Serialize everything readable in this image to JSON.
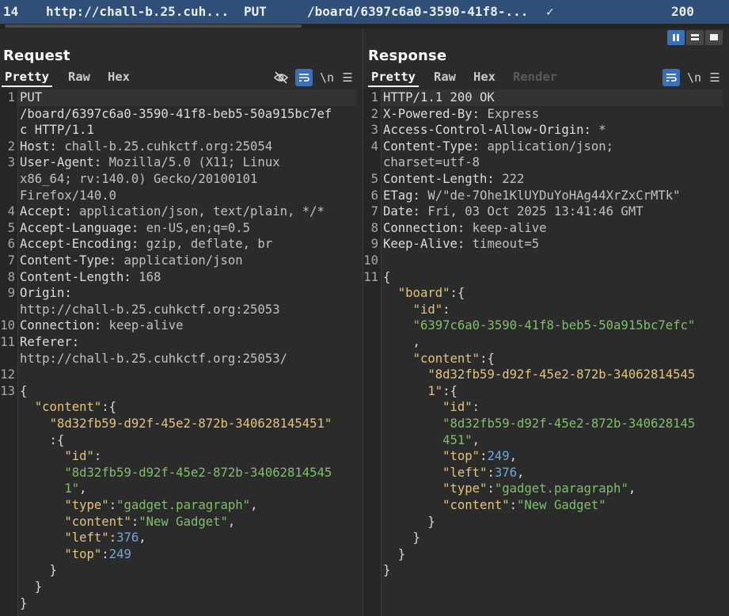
{
  "history_row": {
    "number": "14",
    "host": "http://chall-b.25.cuh...",
    "method": "PUT",
    "path": "/board/6397c6a0-3590-41f8-...",
    "check": "✓",
    "status": "200"
  },
  "request": {
    "title": "Request",
    "tabs": [
      "Pretty",
      "Raw",
      "Hex"
    ],
    "active_tab": "Pretty",
    "tools": {
      "hide_icon": "eye-off-icon",
      "wrap_icon": "wrap-icon",
      "newline_label": "\\n",
      "menu_icon": "menu-icon"
    }
  },
  "response": {
    "title": "Response",
    "tabs": [
      "Pretty",
      "Raw",
      "Hex",
      "Render"
    ],
    "active_tab": "Pretty",
    "tools": {
      "wrap_icon": "wrap-icon",
      "newline_label": "\\n",
      "menu_icon": "menu-icon"
    }
  },
  "request_lines": [
    {
      "n": "1",
      "segs": [
        [
          "hk",
          "PUT"
        ]
      ]
    },
    {
      "n": "",
      "segs": [
        [
          "hk",
          "/board/6397c6a0-3590-41f8-beb5-50a915bc7ef"
        ]
      ]
    },
    {
      "n": "",
      "segs": [
        [
          "hk",
          "c HTTP/1.1"
        ]
      ]
    },
    {
      "n": "2",
      "segs": [
        [
          "hk",
          "Host:"
        ],
        [
          "hv",
          " chall-b.25.cuhkctf.org:25054"
        ]
      ]
    },
    {
      "n": "3",
      "segs": [
        [
          "hk",
          "User-Agent:"
        ],
        [
          "hv",
          " Mozilla/5.0 (X11; Linux"
        ]
      ]
    },
    {
      "n": "",
      "segs": [
        [
          "hv",
          "x86_64; rv:140.0) Gecko/20100101"
        ]
      ]
    },
    {
      "n": "",
      "segs": [
        [
          "hv",
          "Firefox/140.0"
        ]
      ]
    },
    {
      "n": "4",
      "segs": [
        [
          "hk",
          "Accept:"
        ],
        [
          "hv",
          " application/json, text/plain, */*"
        ]
      ]
    },
    {
      "n": "5",
      "segs": [
        [
          "hk",
          "Accept-Language:"
        ],
        [
          "hv",
          " en-US,en;q=0.5"
        ]
      ]
    },
    {
      "n": "6",
      "segs": [
        [
          "hk",
          "Accept-Encoding:"
        ],
        [
          "hv",
          " gzip, deflate, br"
        ]
      ]
    },
    {
      "n": "7",
      "segs": [
        [
          "hk",
          "Content-Type:"
        ],
        [
          "hv",
          " application/json"
        ]
      ]
    },
    {
      "n": "8",
      "segs": [
        [
          "hk",
          "Content-Length:"
        ],
        [
          "hv",
          " 168"
        ]
      ]
    },
    {
      "n": "9",
      "segs": [
        [
          "hk",
          "Origin:"
        ]
      ]
    },
    {
      "n": "",
      "segs": [
        [
          "hv",
          "http://chall-b.25.cuhkctf.org:25053"
        ]
      ]
    },
    {
      "n": "10",
      "segs": [
        [
          "hk",
          "Connection:"
        ],
        [
          "hv",
          " keep-alive"
        ]
      ]
    },
    {
      "n": "11",
      "segs": [
        [
          "hk",
          "Referer:"
        ]
      ]
    },
    {
      "n": "",
      "segs": [
        [
          "hv",
          "http://chall-b.25.cuhkctf.org:25053/"
        ]
      ]
    },
    {
      "n": "12",
      "segs": []
    },
    {
      "n": "13",
      "segs": [
        [
          "jp",
          "{"
        ]
      ]
    },
    {
      "n": "",
      "segs": [
        [
          "jp",
          "  "
        ],
        [
          "jk",
          "\"content\""
        ],
        [
          "jp",
          ":{"
        ]
      ]
    },
    {
      "n": "",
      "segs": [
        [
          "jp",
          "    "
        ],
        [
          "jk",
          "\"8d32fb59-d92f-45e2-872b-340628145451\""
        ]
      ]
    },
    {
      "n": "",
      "segs": [
        [
          "jp",
          "    :{"
        ]
      ]
    },
    {
      "n": "",
      "segs": [
        [
          "jp",
          "      "
        ],
        [
          "jk",
          "\"id\""
        ],
        [
          "jp",
          ":"
        ]
      ]
    },
    {
      "n": "",
      "segs": [
        [
          "jp",
          "      "
        ],
        [
          "js",
          "\"8d32fb59-d92f-45e2-872b-34062814545"
        ]
      ]
    },
    {
      "n": "",
      "segs": [
        [
          "jp",
          "      "
        ],
        [
          "js",
          "1\""
        ],
        [
          "jp",
          ","
        ]
      ]
    },
    {
      "n": "",
      "segs": [
        [
          "jp",
          "      "
        ],
        [
          "jk",
          "\"type\""
        ],
        [
          "jp",
          ":"
        ],
        [
          "js",
          "\"gadget.paragraph\""
        ],
        [
          "jp",
          ","
        ]
      ]
    },
    {
      "n": "",
      "segs": [
        [
          "jp",
          "      "
        ],
        [
          "jk",
          "\"content\""
        ],
        [
          "jp",
          ":"
        ],
        [
          "js",
          "\"New Gadget\""
        ],
        [
          "jp",
          ","
        ]
      ]
    },
    {
      "n": "",
      "segs": [
        [
          "jp",
          "      "
        ],
        [
          "jk",
          "\"left\""
        ],
        [
          "jp",
          ":"
        ],
        [
          "jn",
          "376"
        ],
        [
          "jp",
          ","
        ]
      ]
    },
    {
      "n": "",
      "segs": [
        [
          "jp",
          "      "
        ],
        [
          "jk",
          "\"top\""
        ],
        [
          "jp",
          ":"
        ],
        [
          "jn",
          "249"
        ]
      ]
    },
    {
      "n": "",
      "segs": [
        [
          "jp",
          "    }"
        ]
      ]
    },
    {
      "n": "",
      "segs": [
        [
          "jp",
          "  }"
        ]
      ]
    },
    {
      "n": "",
      "segs": [
        [
          "jp",
          "}"
        ]
      ]
    }
  ],
  "response_lines": [
    {
      "n": "1",
      "segs": [
        [
          "hk",
          "HTTP/1.1 200 OK"
        ]
      ]
    },
    {
      "n": "2",
      "segs": [
        [
          "hk",
          "X-Powered-By:"
        ],
        [
          "hv",
          " Express"
        ]
      ]
    },
    {
      "n": "3",
      "segs": [
        [
          "hk",
          "Access-Control-Allow-Origin:"
        ],
        [
          "hv",
          " *"
        ]
      ]
    },
    {
      "n": "4",
      "segs": [
        [
          "hk",
          "Content-Type:"
        ],
        [
          "hv",
          " application/json;"
        ]
      ]
    },
    {
      "n": "",
      "segs": [
        [
          "hv",
          "charset=utf-8"
        ]
      ]
    },
    {
      "n": "5",
      "segs": [
        [
          "hk",
          "Content-Length:"
        ],
        [
          "hv",
          " 222"
        ]
      ]
    },
    {
      "n": "6",
      "segs": [
        [
          "hk",
          "ETag:"
        ],
        [
          "hv",
          " W/\"de-7Ohe1KlUYDuYoHAg44XrZxCrMTk\""
        ]
      ]
    },
    {
      "n": "7",
      "segs": [
        [
          "hk",
          "Date:"
        ],
        [
          "hv",
          " Fri, 03 Oct 2025 13:41:46 GMT"
        ]
      ]
    },
    {
      "n": "8",
      "segs": [
        [
          "hk",
          "Connection:"
        ],
        [
          "hv",
          " keep-alive"
        ]
      ]
    },
    {
      "n": "9",
      "segs": [
        [
          "hk",
          "Keep-Alive:"
        ],
        [
          "hv",
          " timeout=5"
        ]
      ]
    },
    {
      "n": "10",
      "segs": []
    },
    {
      "n": "11",
      "segs": [
        [
          "jp",
          "{"
        ]
      ]
    },
    {
      "n": "",
      "segs": [
        [
          "jp",
          "  "
        ],
        [
          "jk",
          "\"board\""
        ],
        [
          "jp",
          ":{"
        ]
      ]
    },
    {
      "n": "",
      "segs": [
        [
          "jp",
          "    "
        ],
        [
          "jk",
          "\"id\""
        ],
        [
          "jp",
          ":"
        ]
      ]
    },
    {
      "n": "",
      "segs": [
        [
          "jp",
          "    "
        ],
        [
          "js",
          "\"6397c6a0-3590-41f8-beb5-50a915bc7efc\""
        ]
      ]
    },
    {
      "n": "",
      "segs": [
        [
          "jp",
          "    ,"
        ]
      ]
    },
    {
      "n": "",
      "segs": [
        [
          "jp",
          "    "
        ],
        [
          "jk",
          "\"content\""
        ],
        [
          "jp",
          ":{"
        ]
      ]
    },
    {
      "n": "",
      "segs": [
        [
          "jp",
          "      "
        ],
        [
          "jk",
          "\"8d32fb59-d92f-45e2-872b-34062814545"
        ]
      ]
    },
    {
      "n": "",
      "segs": [
        [
          "jp",
          "      "
        ],
        [
          "jk",
          "1\""
        ],
        [
          "jp",
          ":{"
        ]
      ]
    },
    {
      "n": "",
      "segs": [
        [
          "jp",
          "        "
        ],
        [
          "jk",
          "\"id\""
        ],
        [
          "jp",
          ":"
        ]
      ]
    },
    {
      "n": "",
      "segs": [
        [
          "jp",
          "        "
        ],
        [
          "js",
          "\"8d32fb59-d92f-45e2-872b-340628145"
        ]
      ]
    },
    {
      "n": "",
      "segs": [
        [
          "jp",
          "        "
        ],
        [
          "js",
          "451\""
        ],
        [
          "jp",
          ","
        ]
      ]
    },
    {
      "n": "",
      "segs": [
        [
          "jp",
          "        "
        ],
        [
          "jk",
          "\"top\""
        ],
        [
          "jp",
          ":"
        ],
        [
          "jn",
          "249"
        ],
        [
          "jp",
          ","
        ]
      ]
    },
    {
      "n": "",
      "segs": [
        [
          "jp",
          "        "
        ],
        [
          "jk",
          "\"left\""
        ],
        [
          "jp",
          ":"
        ],
        [
          "jn",
          "376"
        ],
        [
          "jp",
          ","
        ]
      ]
    },
    {
      "n": "",
      "segs": [
        [
          "jp",
          "        "
        ],
        [
          "jk",
          "\"type\""
        ],
        [
          "jp",
          ":"
        ],
        [
          "js",
          "\"gadget.paragraph\""
        ],
        [
          "jp",
          ","
        ]
      ]
    },
    {
      "n": "",
      "segs": [
        [
          "jp",
          "        "
        ],
        [
          "jk",
          "\"content\""
        ],
        [
          "jp",
          ":"
        ],
        [
          "js",
          "\"New Gadget\""
        ]
      ]
    },
    {
      "n": "",
      "segs": [
        [
          "jp",
          "      }"
        ]
      ]
    },
    {
      "n": "",
      "segs": [
        [
          "jp",
          "    }"
        ]
      ]
    },
    {
      "n": "",
      "segs": [
        [
          "jp",
          "  }"
        ]
      ]
    },
    {
      "n": "",
      "segs": [
        [
          "jp",
          "}"
        ]
      ]
    }
  ]
}
